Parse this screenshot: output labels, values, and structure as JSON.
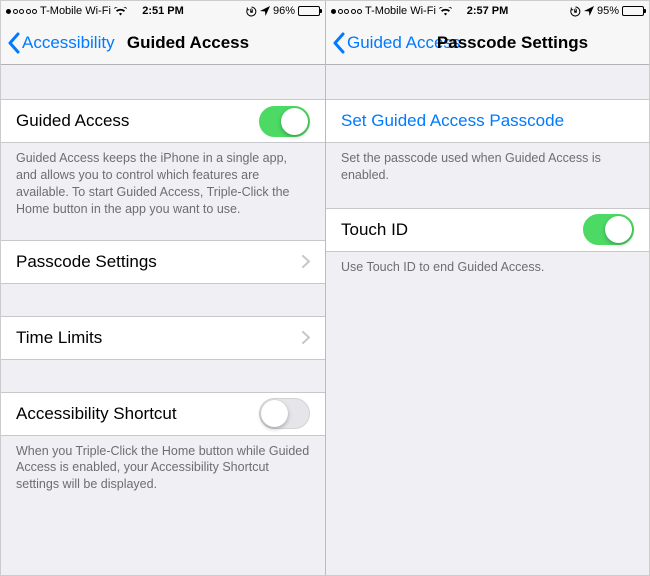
{
  "left": {
    "statusbar": {
      "signal_filled": 1,
      "carrier": "T-Mobile Wi-Fi",
      "time": "2:51 PM",
      "battery_pct": "96%",
      "battery_level": 96
    },
    "nav": {
      "back": "Accessibility",
      "title": "Guided Access"
    },
    "rows": {
      "guided_access": {
        "label": "Guided Access",
        "on": true
      },
      "guided_access_footer": "Guided Access keeps the iPhone in a single app, and allows you to control which features are available. To start Guided Access, Triple-Click the Home button in the app you want to use.",
      "passcode_settings": {
        "label": "Passcode Settings"
      },
      "time_limits": {
        "label": "Time Limits"
      },
      "accessibility_shortcut": {
        "label": "Accessibility Shortcut",
        "on": false
      },
      "accessibility_shortcut_footer": "When you Triple-Click the Home button while Guided Access is enabled, your Accessibility Shortcut settings will be displayed."
    }
  },
  "right": {
    "statusbar": {
      "signal_filled": 1,
      "carrier": "T-Mobile Wi-Fi",
      "time": "2:57 PM",
      "battery_pct": "95%",
      "battery_level": 95
    },
    "nav": {
      "back": "Guided Access",
      "title": "Passcode Settings"
    },
    "rows": {
      "set_passcode": {
        "label": "Set Guided Access Passcode"
      },
      "set_passcode_footer": "Set the passcode used when Guided Access is enabled.",
      "touch_id": {
        "label": "Touch ID",
        "on": true
      },
      "touch_id_footer": "Use Touch ID to end Guided Access."
    }
  }
}
